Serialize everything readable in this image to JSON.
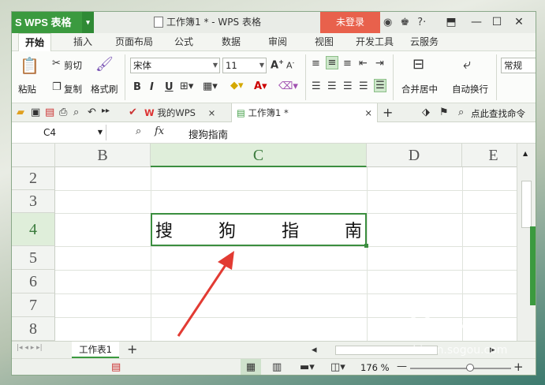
{
  "titlebar": {
    "app_name": "WPS 表格",
    "document_title": "工作簿1 * - WPS 表格",
    "login_label": "未登录",
    "icons": [
      "skin-icon",
      "shirt-icon",
      "help-icon",
      "upload-icon"
    ],
    "help_label": "?·"
  },
  "ribbon_tabs": [
    "开始",
    "插入",
    "页面布局",
    "公式",
    "数据",
    "审阅",
    "视图",
    "开发工具",
    "云服务"
  ],
  "ribbon": {
    "paste_label": "粘贴",
    "cut_label": "剪切",
    "copy_label": "复制",
    "format_painter_label": "格式刷",
    "font_name": "宋体",
    "font_size": "11",
    "bold": "B",
    "italic": "I",
    "underline": "U",
    "merge_center_label": "合并居中",
    "wrap_label": "自动换行",
    "number_format": "常规"
  },
  "doc_tabs": {
    "my_wps_label": "我的WPS",
    "workbook_label": "工作簿1 *",
    "search_label": "点此查找命令"
  },
  "formula_bar": {
    "cell_ref": "C4",
    "fx_label": "fx",
    "value": "搜狗指南"
  },
  "grid": {
    "columns": [
      "B",
      "C",
      "D",
      "E"
    ],
    "rows": [
      "2",
      "3",
      "4",
      "5",
      "6",
      "7",
      "8"
    ],
    "selected_cell": "C4",
    "cell_c4_chars": [
      "搜",
      "狗",
      "指",
      "南"
    ]
  },
  "sheet_tabs": {
    "active_sheet": "工作表1",
    "add_label": "+"
  },
  "statusbar": {
    "zoom": "176 %",
    "minus": "—",
    "plus": "+"
  },
  "watermark": {
    "brand": "搜狗指南",
    "url": "zhinan.sogou.com"
  },
  "colors": {
    "accent": "#3b9a3f",
    "login": "#e8614c",
    "selection": "#3b8e3f",
    "arrow": "#e23b33"
  }
}
